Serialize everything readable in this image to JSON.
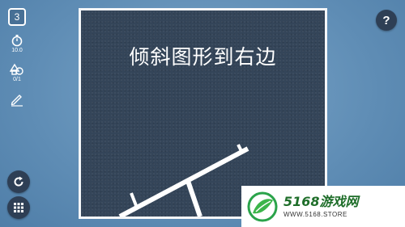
{
  "hud": {
    "level": "3",
    "timer_value": "10.0",
    "shape_count": "0/1",
    "icons": {
      "timer": "stopwatch-icon",
      "shapes": "shapes-icon",
      "edit": "pencil-icon",
      "restart": "restart-icon",
      "menu": "grid-menu-icon"
    },
    "help_label": "?"
  },
  "board": {
    "title": "倾斜图形到右边"
  },
  "watermark": {
    "brand": "5168游戏网",
    "site": "WWW.5168.STORE"
  },
  "colors": {
    "background": "#5f8db5",
    "board": "#344559",
    "button": "#2e3f55",
    "brand_green": "#1f6e2a"
  }
}
